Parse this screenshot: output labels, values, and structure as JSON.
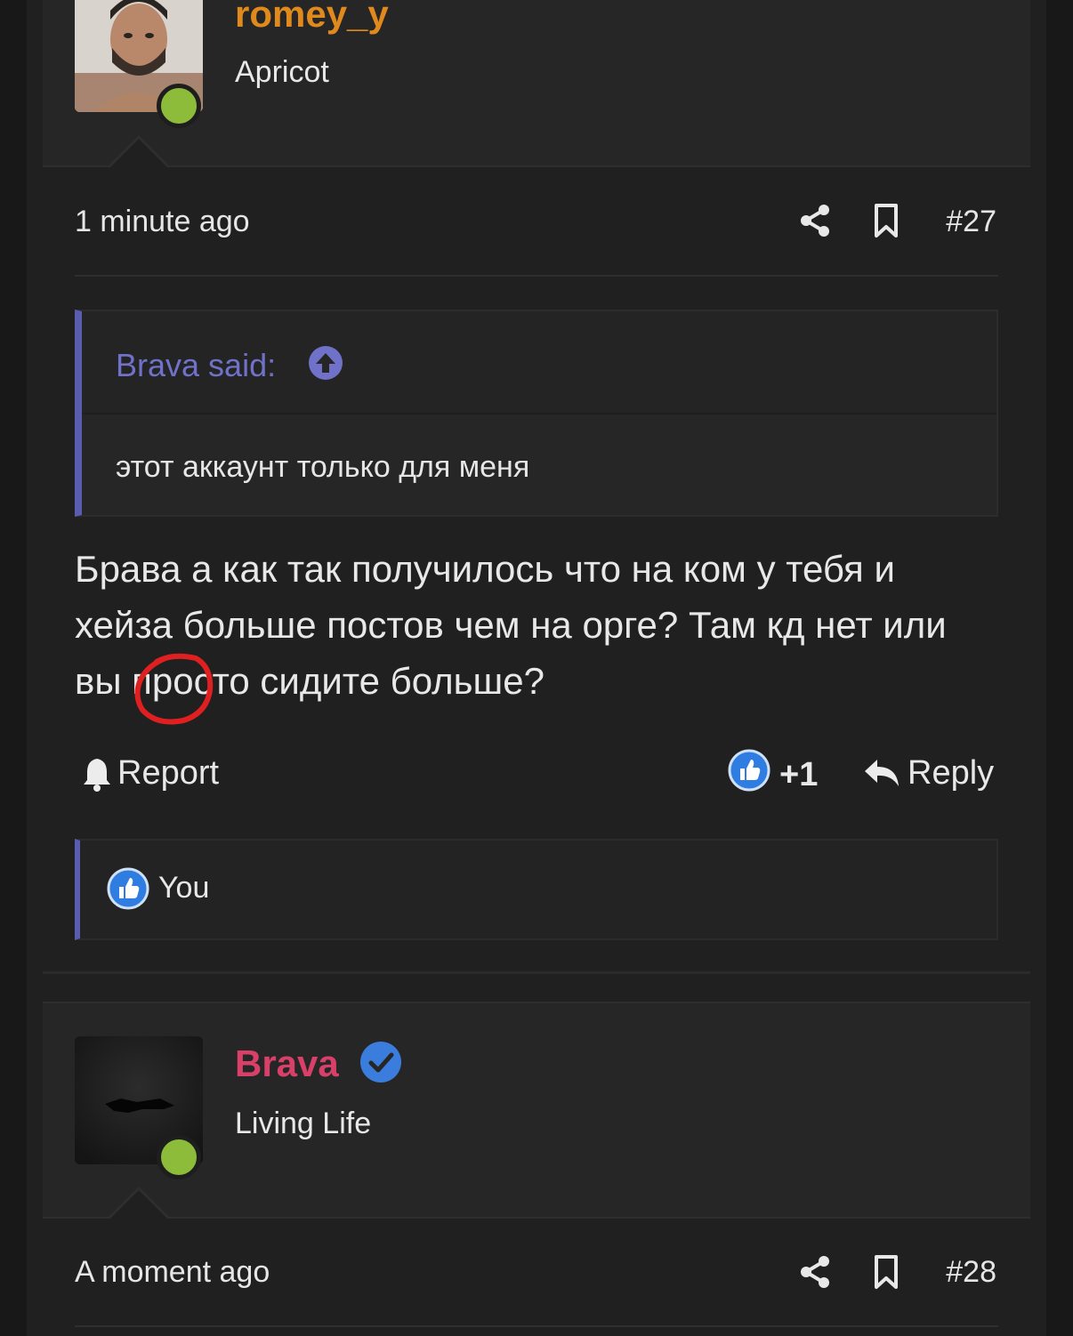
{
  "post1": {
    "username": "romey_y",
    "user_title": "Apricot",
    "time": "1 minute ago",
    "post_number": "#27",
    "quote": {
      "author": "Brava said:",
      "text": "этот аккаунт только для меня"
    },
    "message": "Брава а как так получилось что на ком у тебя и хейза больше постов чем на орге? Там кд нет или вы просто сидите больше?",
    "actions": {
      "report": "Report",
      "reaction_count": "+1",
      "reply": "Reply"
    },
    "reacted_by": "You"
  },
  "post2": {
    "username": "Brava",
    "user_title": "Living Life",
    "time": "A moment ago",
    "post_number": "#28"
  },
  "colors": {
    "username_orange": "#e08a1e",
    "username_pink": "#d8406a",
    "quote_accent": "#5a5cb0",
    "online_green": "#8dbb3a",
    "verified_blue": "#3b7ddd",
    "like_blue": "#2f7de1",
    "annotation_red": "#e02020"
  }
}
